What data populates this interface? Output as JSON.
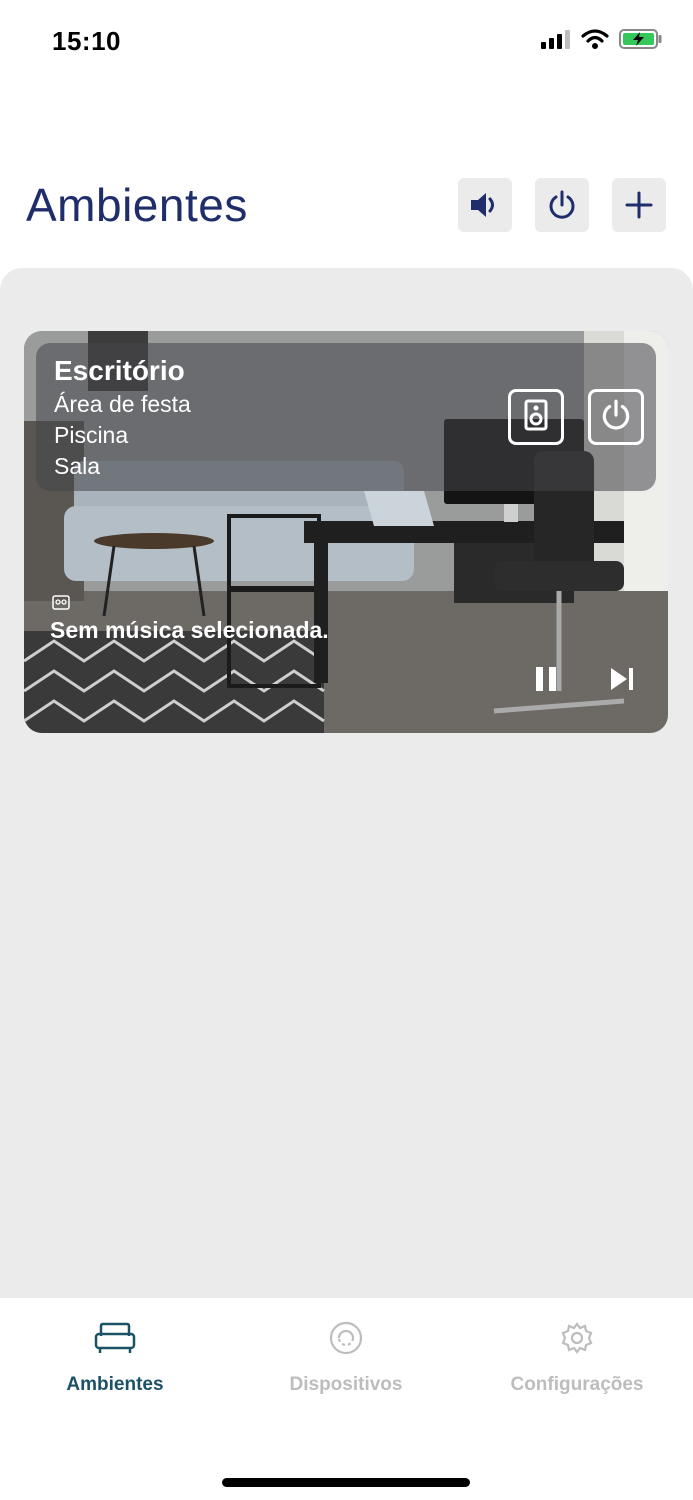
{
  "status_bar": {
    "time": "15:10",
    "icons": [
      "signal-icon",
      "wifi-icon",
      "battery-charging-icon"
    ]
  },
  "header": {
    "title": "Ambientes",
    "buttons": [
      "volume-icon",
      "power-icon",
      "plus-icon"
    ]
  },
  "room_card": {
    "name": "Escritório",
    "zones": [
      "Área de festa",
      "Piscina",
      "Sala"
    ],
    "now_playing": "Sem música selecionada.",
    "buttons": [
      "speaker-icon",
      "power-icon"
    ],
    "controls": [
      "pause-icon",
      "skip-next-icon"
    ]
  },
  "tab_bar": {
    "tabs": [
      {
        "label": "Ambientes",
        "icon": "sofa-icon",
        "active": true
      },
      {
        "label": "Dispositivos",
        "icon": "device-icon",
        "active": false
      },
      {
        "label": "Configurações",
        "icon": "gear-icon",
        "active": false
      }
    ]
  },
  "colors": {
    "title": "#1f2d6b",
    "tab_active": "#1c5266",
    "tab_inactive": "#bdbdbd",
    "background_panel": "#ebebeb"
  }
}
